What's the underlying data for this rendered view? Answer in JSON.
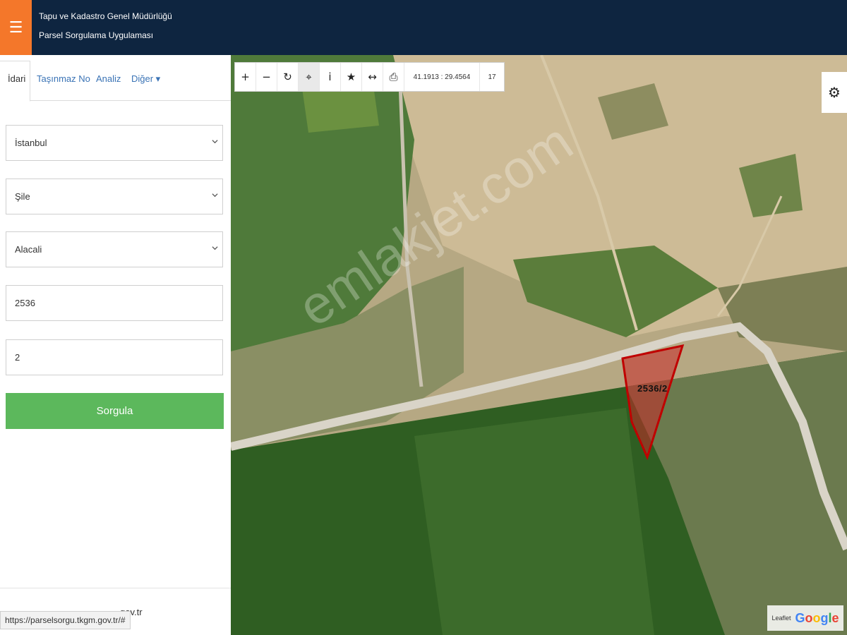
{
  "header": {
    "menu_icon": "hamburger-icon",
    "title_line1": "Tapu ve Kadastro Genel Müdürlüğü",
    "title_line2": "Parsel Sorgulama Uygulaması",
    "colors": {
      "header_bg": "#0e2540",
      "menu_bg": "#f4772a"
    }
  },
  "sidebar": {
    "tabs": [
      {
        "label": "İdari",
        "active": true
      },
      {
        "label": "Taşınmaz No",
        "active": false
      },
      {
        "label": "Analiz",
        "active": false
      },
      {
        "label": "Diğer ▾",
        "active": false
      }
    ],
    "form": {
      "il": "İstanbul",
      "ilce": "Şile",
      "mahalle": "Alacali",
      "ada": "2536",
      "parsel": "2",
      "submit_label": "Sorgula"
    },
    "footer_link": "gov.tr"
  },
  "status_url": "https://parselsorgu.tkgm.gov.tr/#",
  "map": {
    "toolbar": {
      "zoom_in_icon": "+",
      "zoom_out_icon": "−",
      "refresh_icon": "↻",
      "locate_icon": "⌖",
      "info_icon": "i",
      "favorite_icon": "★",
      "measure_icon": "↔",
      "print_icon": "⎙",
      "coordinates": "41.1913 : 29.4564",
      "zoom_level": "17"
    },
    "settings_icon": "⚙",
    "parcel_label": "2536/2",
    "watermark": "emlakjet.com",
    "attribution": {
      "leaflet": "Leaflet",
      "google": "Google"
    }
  }
}
